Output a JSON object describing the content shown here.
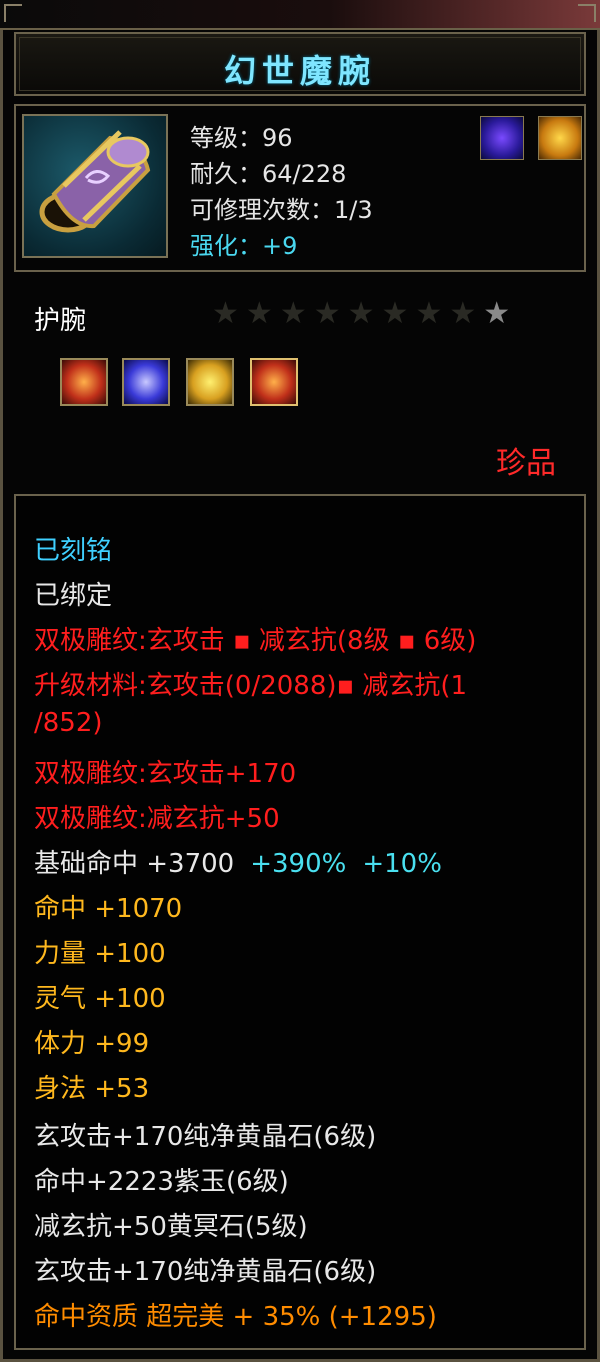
{
  "title": "幻世魔腕",
  "item": {
    "icon": "purple-gold-wrist-guard-icon",
    "level_label": "等级：96",
    "durability_label": "耐久：64/228",
    "repair_label": "可修理次数：1/3",
    "enhance_label": "强化：+9"
  },
  "runes": [
    "purple-wing-rune-icon",
    "golden-flame-rune-icon"
  ],
  "equip_type": "护腕",
  "stars": {
    "total": 9,
    "lit": 1
  },
  "gems": [
    "red-gem-icon",
    "blue-gem-icon",
    "yellow-crystal-icon",
    "red-gem-selected-icon"
  ],
  "rarity": "珍品",
  "description": {
    "engraved": "已刻铭",
    "bound": "已绑定",
    "carve_line": "双极雕纹:玄攻击 ▪ 减玄抗(8级 ▪ 6级)",
    "upgrade_line1": "升级材料:玄攻击(0/2088)▪ 减玄抗(1",
    "upgrade_line2": "/852)",
    "carve_attack": "双极雕纹:玄攻击+170",
    "carve_resist": "双极雕纹:减玄抗+50",
    "base_hit_label": "基础命中 +3700",
    "base_hit_pct1": "+390%",
    "base_hit_pct2": "+10%",
    "attrs": [
      "命中 +1070",
      "力量 +100",
      "灵气 +100",
      "体力 +99",
      "身法 +53"
    ],
    "gem_lines": [
      "玄攻击+170纯净黄晶石(6级)",
      "命中+2223紫玉(6级)",
      "减玄抗+50黄冥石(5级)",
      "玄攻击+170纯净黄晶石(6级)"
    ],
    "aptitude": "命中资质 超完美 + 35% (+1295)"
  },
  "colors": {
    "title": "#7fe6ff",
    "cyan": "#3fd0ff",
    "red": "#ff1e1e",
    "gold": "#ffb81e",
    "orange": "#ff8c00",
    "border": "#6a624c"
  }
}
